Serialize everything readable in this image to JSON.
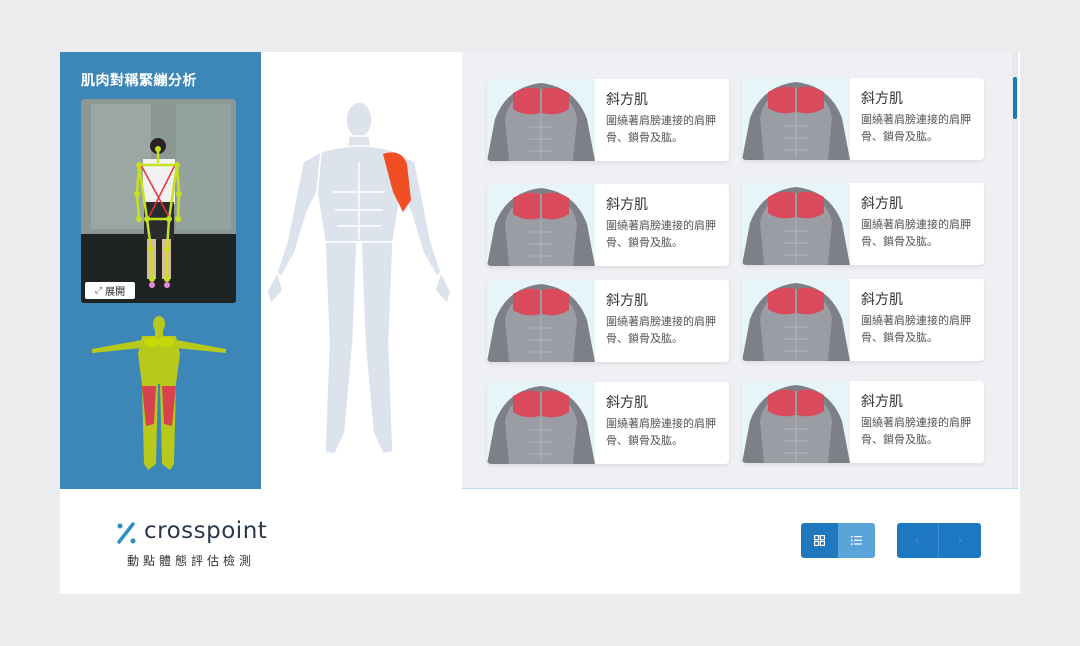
{
  "panel": {
    "title": "肌肉對稱緊繃分析",
    "expand_label": "展開"
  },
  "cards": [
    {
      "title": "斜方肌",
      "desc": "圍繞著肩膀連接的肩胛骨、鎖骨及肱。"
    },
    {
      "title": "斜方肌",
      "desc": "圍繞著肩膀連接的肩胛骨、鎖骨及肱。"
    },
    {
      "title": "斜方肌",
      "desc": "圍繞著肩膀連接的肩胛骨、鎖骨及肱。"
    },
    {
      "title": "斜方肌",
      "desc": "圍繞著肩膀連接的肩胛骨、鎖骨及肱。"
    },
    {
      "title": "斜方肌",
      "desc": "圍繞著肩膀連接的肩胛骨、鎖骨及肱。"
    },
    {
      "title": "斜方肌",
      "desc": "圍繞著肩膀連接的肩胛骨、鎖骨及肱。"
    },
    {
      "title": "斜方肌",
      "desc": "圍繞著肩膀連接的肩胛骨、鎖骨及肱。"
    },
    {
      "title": "斜方肌",
      "desc": "圍繞著肩膀連接的肩胛骨、鎖骨及肱。"
    }
  ],
  "brand": {
    "name": "crosspoint",
    "tagline": "動點體態評估檢測"
  },
  "icons": {
    "grid": "grid-icon",
    "list": "list-icon",
    "prev": "chevron-left-icon",
    "next": "chevron-right-icon",
    "expand": "expand-icon"
  },
  "colors": {
    "panel_blue": "#3c87b7",
    "accent": "#1f78bd",
    "highlight_muscle": "#f04e23",
    "chest_muscle": "#d94a5c"
  }
}
